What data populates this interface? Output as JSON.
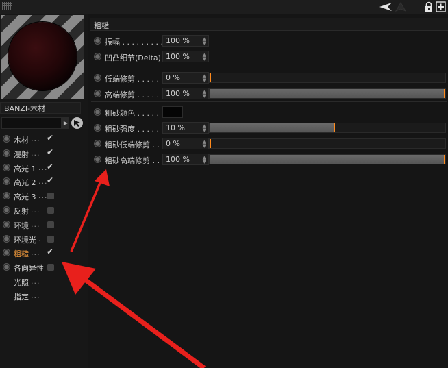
{
  "toolbar": {
    "icons": [
      "panel-grip-icon",
      "arrow-left-icon",
      "arrow-up-icon",
      "lock-icon",
      "add-panel-icon"
    ]
  },
  "material": {
    "name": "BANZI-木材"
  },
  "channels": [
    {
      "label": "木材",
      "dots": "...",
      "state": "checked"
    },
    {
      "label": "漫射",
      "dots": "...",
      "state": "checked"
    },
    {
      "label": "高光 1",
      "dots": "...",
      "state": "checked"
    },
    {
      "label": "高光 2",
      "dots": "...",
      "state": "checked"
    },
    {
      "label": "高光 3",
      "dots": "...",
      "state": "unchecked"
    },
    {
      "label": "反射",
      "dots": "...",
      "state": "unchecked"
    },
    {
      "label": "环境",
      "dots": "...",
      "state": "unchecked"
    },
    {
      "label": "环境光",
      "dots": ".",
      "state": "unchecked"
    },
    {
      "label": "粗糙",
      "dots": "...",
      "state": "checked",
      "active": true
    },
    {
      "label": "各向异性",
      "dots": "",
      "state": "unchecked"
    },
    {
      "label": "光照",
      "dots": "...",
      "state": "none"
    },
    {
      "label": "指定",
      "dots": "...",
      "state": "none"
    }
  ],
  "section": {
    "title": "粗糙"
  },
  "params": [
    {
      "label": "振幅 . . . . . . . . .",
      "value": "100 %",
      "slider": null
    },
    {
      "label": "凹凸细节(Delta)",
      "value": "100 %",
      "slider": null
    },
    {
      "label": "低端修剪 . . . . . .",
      "value": "0 %",
      "slider": 0
    },
    {
      "label": "高端修剪 . . . . . .",
      "value": "100 %",
      "slider": 1
    },
    {
      "label": "粗砂颜色 . . . . .",
      "value": "",
      "slider": null,
      "swatch": "#050505"
    },
    {
      "label": "粗砂强度 . . . . . .",
      "value": "10 %",
      "slider": 0.53
    },
    {
      "label": "粗砂低端修剪 . .",
      "value": "0 %",
      "slider": 0
    },
    {
      "label": "粗砂高端修剪 . .",
      "value": "100 %",
      "slider": 1
    }
  ],
  "colors": {
    "accent": "#ff8a1c",
    "active_label": "#e8943a",
    "annotation": "#e8201c"
  }
}
